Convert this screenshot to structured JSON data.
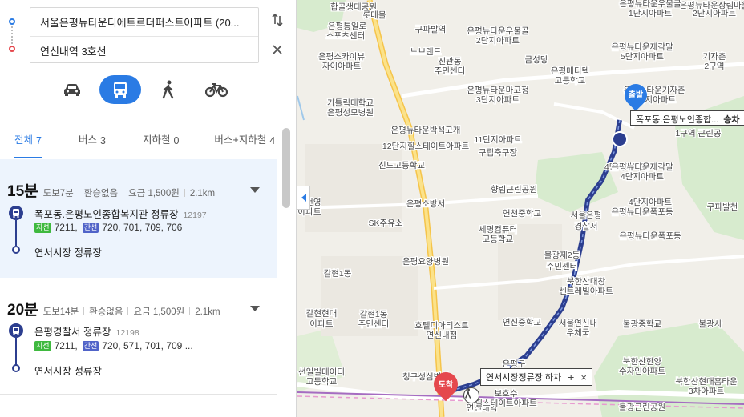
{
  "route": {
    "origin": "서울은평뉴타운디에트르더퍼스트아파트 (20...",
    "destination": "연신내역 3호선"
  },
  "tabs": [
    {
      "label": "전체",
      "count": "7"
    },
    {
      "label": "버스",
      "count": "3"
    },
    {
      "label": "지하철",
      "count": "0"
    },
    {
      "label": "버스+지하철",
      "count": "4"
    }
  ],
  "results": [
    {
      "time": "15분",
      "walk": "도보7분",
      "transfer": "환승없음",
      "fare": "요금 1,500원",
      "distance": "2.1km",
      "start_stop": "폭포동.은평노인종합복지관 정류장",
      "start_id": "12197",
      "badge1": "지선",
      "lines1": "7211,",
      "badge2": "간선",
      "lines2": "720, 701, 709, 706",
      "end_stop": "연서시장 정류장"
    },
    {
      "time": "20분",
      "walk": "도보14분",
      "transfer": "환승없음",
      "fare": "요금 1,500원",
      "distance": "2.1km",
      "start_stop": "은평경찰서 정류장",
      "start_id": "12198",
      "badge1": "지선",
      "lines1": "7211,",
      "badge2": "간선",
      "lines2": "720, 571, 701, 709 ...",
      "end_stop": "연서시장 정류장"
    }
  ],
  "map": {
    "start_marker": "출발",
    "end_marker": "도착",
    "start_callout": "폭포동.은평노인종합...",
    "start_action": "승차",
    "end_callout": "연서시장정류장 하차",
    "labels": [
      "합골생태공원",
      "롯데몰",
      "은평통일로",
      "스포츠센터",
      "구파발역",
      "은평뉴타운우물골",
      "2단지아파트",
      "은평스카이뷰",
      "자이아파트",
      "노브랜드",
      "진관동",
      "주민센터",
      "금성당",
      "은평뉴타운제각말",
      "5단지아파트",
      "은평메디텍",
      "고등학교",
      "기자촌",
      "2구역",
      "은평뉴타운마고정",
      "3단지아파트",
      "은평뉴타운기자촌",
      "1단지아파트",
      "가톨릭대학교",
      "은평성모병원",
      "은평뉴타운박석고개",
      "12단지힐스테이트아파트",
      "11단지아파트",
      "구립축구장",
      "신도고등학교",
      "1구역 근린공",
      "4단지아파트",
      "향림근린공원",
      "연천중학교",
      "은평뉴타운폭포동",
      "은평소방서",
      "SK주유소",
      "세명컴퓨터",
      "고등학교",
      "서울은평",
      "경찰서",
      "은평요양병원",
      "불광제2동",
      "주민센터",
      "갈현1동",
      "4단지아파트",
      "은평뉴타운폭포동",
      "북한산대창",
      "센트레빌아파트",
      "갈현현대",
      "아파트",
      "갈현1동",
      "주민센터",
      "호텔디아티스트",
      "연신내점",
      "연신중학교",
      "서울연신내",
      "우체국",
      "불광중학교",
      "불광사",
      "선일빌데이터",
      "고등학교",
      "청구성심병원",
      "북한산한양",
      "수자인아파트",
      "북한산현대홈타운",
      "3차아파트",
      "불광근린공원",
      "연신내역",
      "보호수",
      "힐스테이트아파트",
      "은평구",
      "선건영",
      "아파트",
      "구파발천",
      "은평뉴타운상림마을",
      "2단지아파트",
      "은평뉴타운우물골",
      "1단지아파트",
      "은평뉴타운제각말",
      "4단지아파트"
    ]
  },
  "colors": {
    "accent": "#2a7be4",
    "bus_route": "#2c3e8f",
    "dest_marker": "#e5484d",
    "major_road": "#f5c44a"
  },
  "icons": [
    "swap-icon",
    "close-icon",
    "car-icon",
    "bus-icon",
    "walk-icon",
    "bike-icon",
    "chevron-down-icon"
  ]
}
